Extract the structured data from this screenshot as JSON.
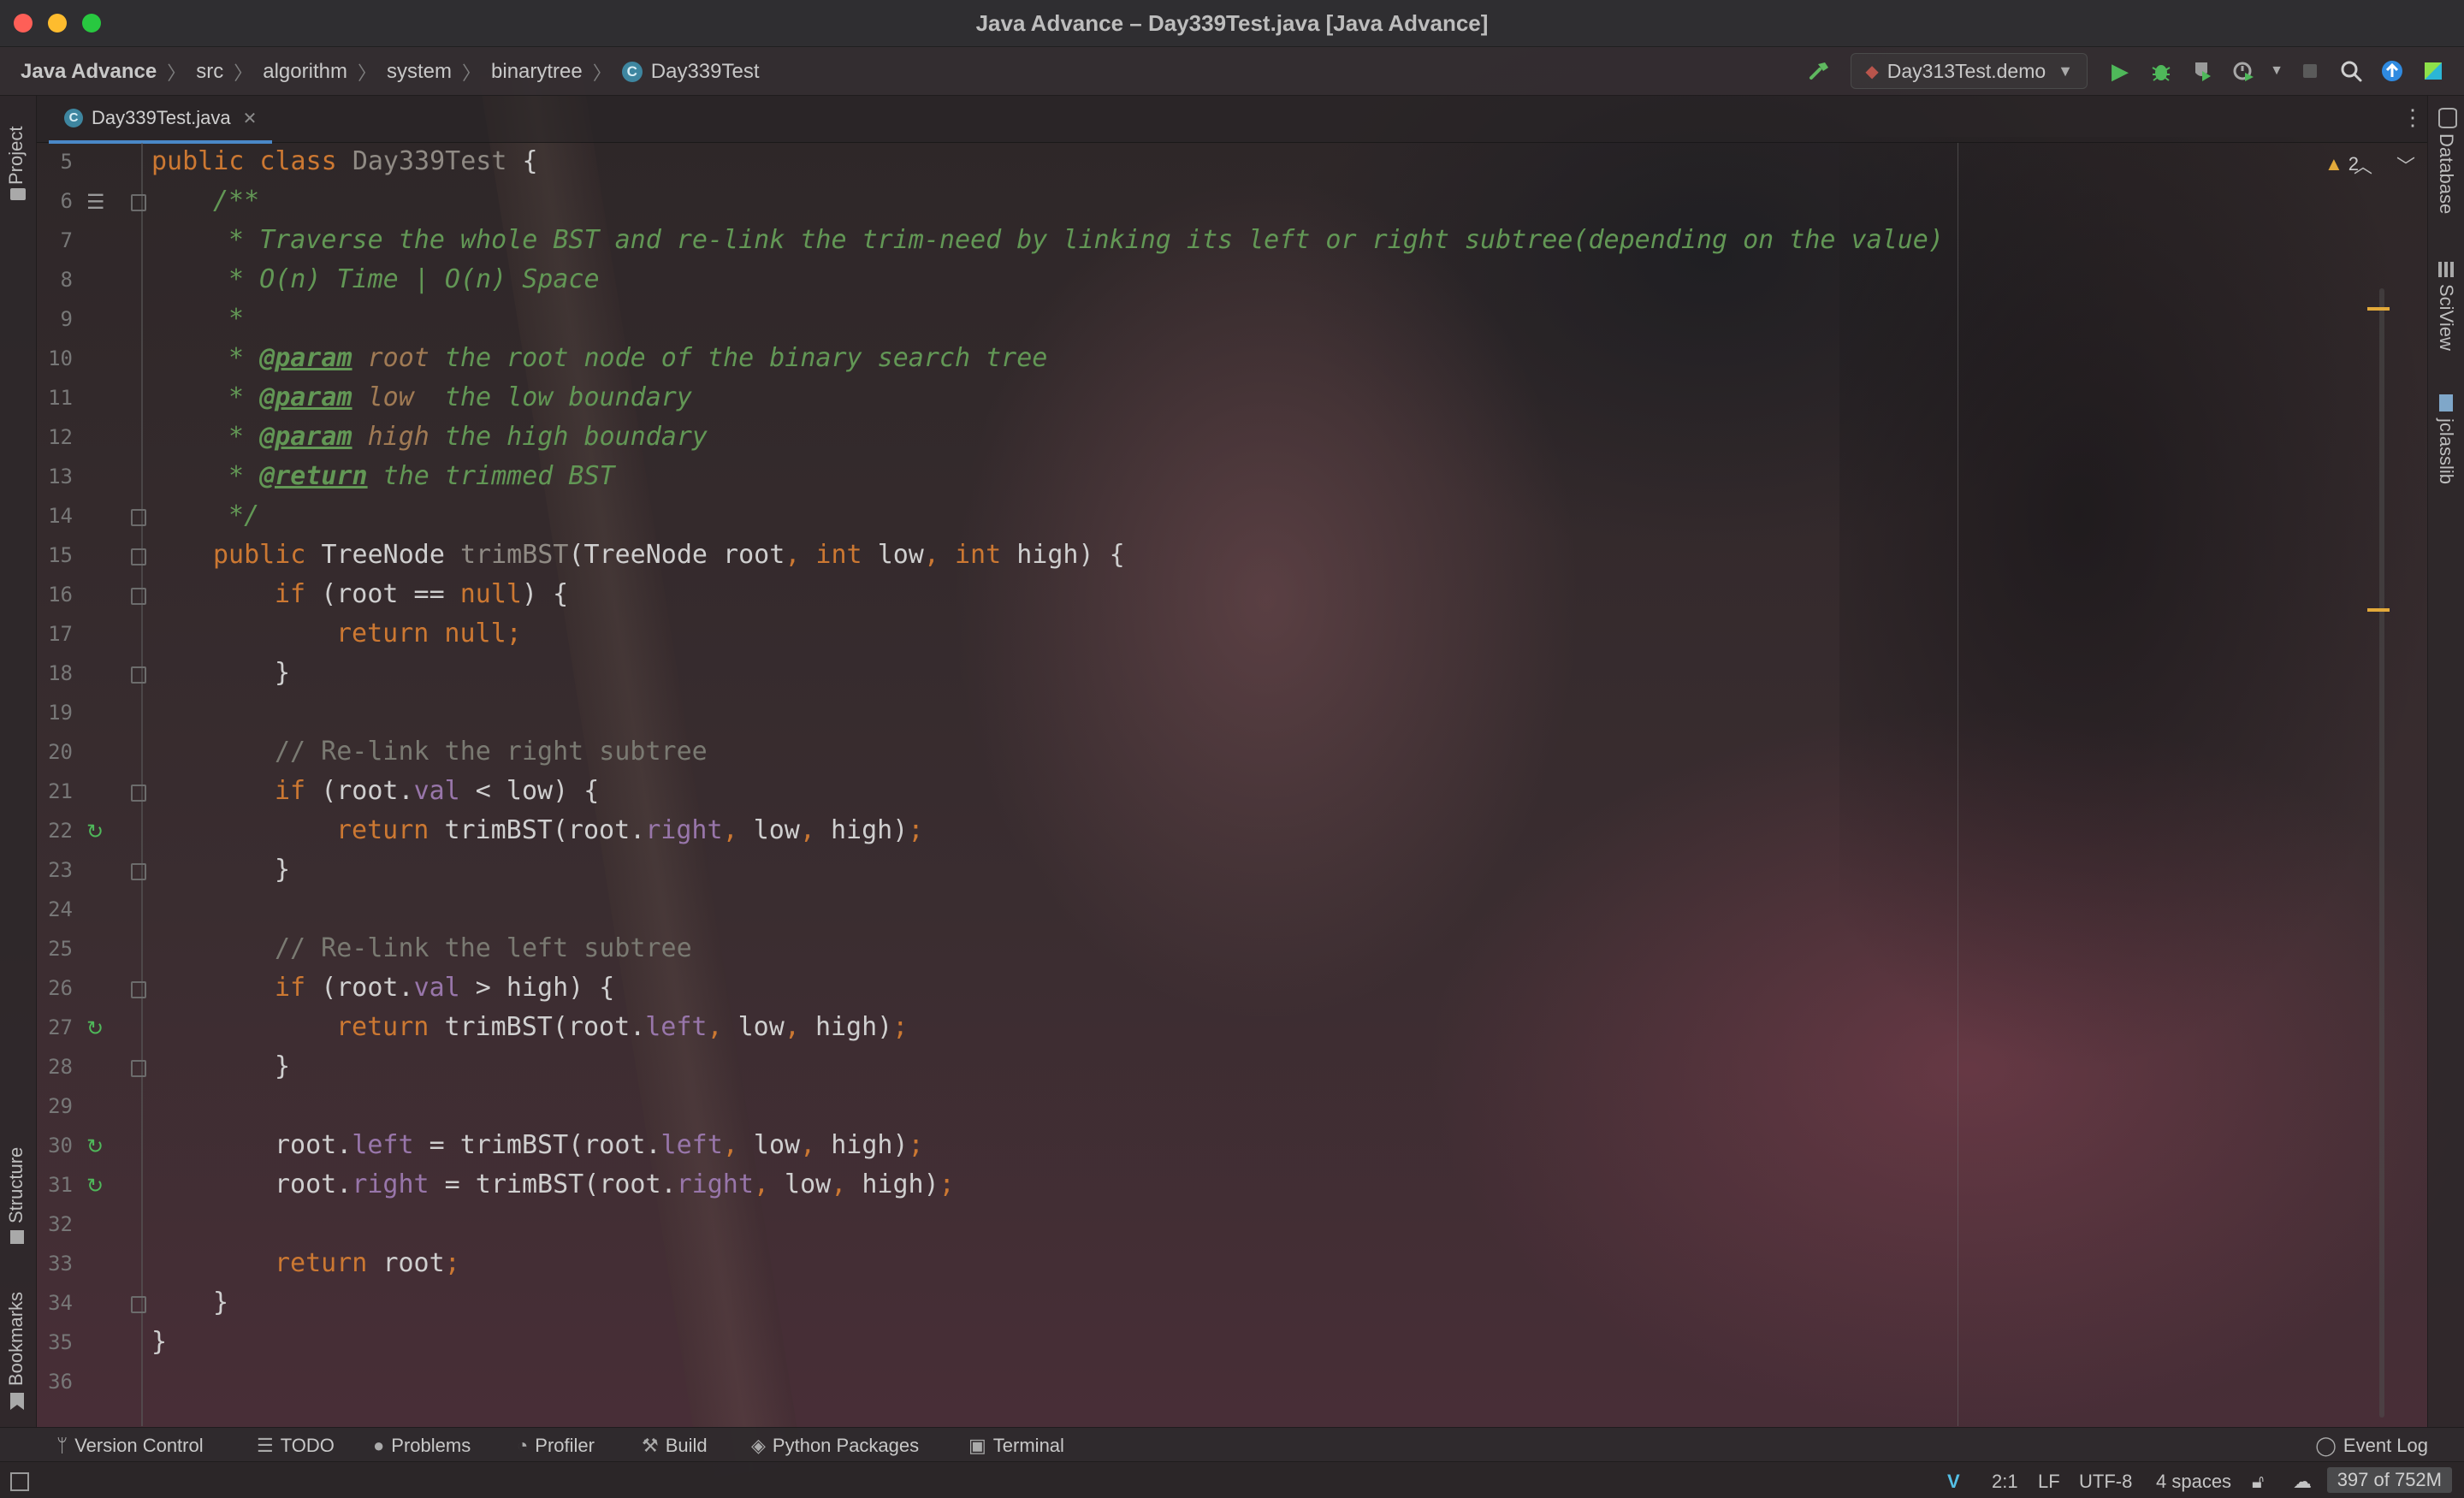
{
  "window": {
    "title": "Java Advance – Day339Test.java [Java Advance]"
  },
  "breadcrumbs": [
    "Java Advance",
    "src",
    "algorithm",
    "system",
    "binarytree",
    "Day339Test"
  ],
  "toolbar": {
    "run_config": "Day313Test.demo"
  },
  "left_strip": {
    "project": "Project",
    "structure": "Structure",
    "bookmarks": "Bookmarks"
  },
  "right_strip": {
    "database": "Database",
    "sciview": "SciView",
    "jclasslib": "jclasslib"
  },
  "tab": {
    "label": "Day339Test.java"
  },
  "inspection": {
    "warnings": "2"
  },
  "editor": {
    "lines": [
      {
        "n": "5",
        "indent": 0,
        "tokens": [
          [
            "kw",
            "public class "
          ],
          [
            "decl",
            "Day339Test"
          ],
          [
            "p",
            " {"
          ]
        ]
      },
      {
        "n": "6",
        "indent": 1,
        "tokens": [
          [
            "doc",
            "/**"
          ]
        ]
      },
      {
        "n": "7",
        "indent": 1,
        "tokens": [
          [
            "doc",
            " * Traverse the whole BST and re-link the trim-need by linking its left or right subtree(depending on the value)"
          ]
        ]
      },
      {
        "n": "8",
        "indent": 1,
        "tokens": [
          [
            "doc",
            " * O(n) Time | O(n) Space"
          ]
        ]
      },
      {
        "n": "9",
        "indent": 1,
        "tokens": [
          [
            "doc",
            " *"
          ]
        ]
      },
      {
        "n": "10",
        "indent": 1,
        "tokens": [
          [
            "doc",
            " * "
          ],
          [
            "tag",
            "@param"
          ],
          [
            "doc",
            " "
          ],
          [
            "pname",
            "root"
          ],
          [
            "doc",
            " the root node of the binary search tree"
          ]
        ]
      },
      {
        "n": "11",
        "indent": 1,
        "tokens": [
          [
            "doc",
            " * "
          ],
          [
            "tag",
            "@param"
          ],
          [
            "doc",
            " "
          ],
          [
            "pname",
            "low"
          ],
          [
            "doc",
            "  the low boundary"
          ]
        ]
      },
      {
        "n": "12",
        "indent": 1,
        "tokens": [
          [
            "doc",
            " * "
          ],
          [
            "tag",
            "@param"
          ],
          [
            "doc",
            " "
          ],
          [
            "pname",
            "high"
          ],
          [
            "doc",
            " the high boundary"
          ]
        ]
      },
      {
        "n": "13",
        "indent": 1,
        "tokens": [
          [
            "doc",
            " * "
          ],
          [
            "tag",
            "@return"
          ],
          [
            "doc",
            " the trimmed BST"
          ]
        ]
      },
      {
        "n": "14",
        "indent": 1,
        "tokens": [
          [
            "doc",
            " */"
          ]
        ]
      },
      {
        "n": "15",
        "indent": 1,
        "tokens": [
          [
            "kw",
            "public "
          ],
          [
            "p",
            "TreeNode "
          ],
          [
            "decl",
            "trimBST"
          ],
          [
            "p",
            "(TreeNode root"
          ],
          [
            "kw",
            ", int "
          ],
          [
            "p",
            "low"
          ],
          [
            "kw",
            ", int "
          ],
          [
            "p",
            "high) {"
          ]
        ]
      },
      {
        "n": "16",
        "indent": 2,
        "tokens": [
          [
            "kw",
            "if "
          ],
          [
            "p",
            "(root == "
          ],
          [
            "kw",
            "null"
          ],
          [
            "p",
            ") {"
          ]
        ]
      },
      {
        "n": "17",
        "indent": 3,
        "tokens": [
          [
            "kw",
            "return null;"
          ]
        ]
      },
      {
        "n": "18",
        "indent": 2,
        "tokens": [
          [
            "p",
            "}"
          ]
        ]
      },
      {
        "n": "19",
        "indent": 0,
        "tokens": []
      },
      {
        "n": "20",
        "indent": 2,
        "tokens": [
          [
            "cm",
            "// Re-link the right subtree"
          ]
        ]
      },
      {
        "n": "21",
        "indent": 2,
        "tokens": [
          [
            "kw",
            "if "
          ],
          [
            "p",
            "(root."
          ],
          [
            "fld",
            "val"
          ],
          [
            "p",
            " < low) {"
          ]
        ]
      },
      {
        "n": "22",
        "indent": 3,
        "tokens": [
          [
            "kw",
            "return "
          ],
          [
            "p",
            "trimBST(root."
          ],
          [
            "fld",
            "right"
          ],
          [
            "kw",
            ", "
          ],
          [
            "p",
            "low"
          ],
          [
            "kw",
            ", "
          ],
          [
            "p",
            "high)"
          ],
          [
            "kw",
            ";"
          ]
        ]
      },
      {
        "n": "23",
        "indent": 2,
        "tokens": [
          [
            "p",
            "}"
          ]
        ]
      },
      {
        "n": "24",
        "indent": 0,
        "tokens": []
      },
      {
        "n": "25",
        "indent": 2,
        "tokens": [
          [
            "cm",
            "// Re-link the left subtree"
          ]
        ]
      },
      {
        "n": "26",
        "indent": 2,
        "tokens": [
          [
            "kw",
            "if "
          ],
          [
            "p",
            "(root."
          ],
          [
            "fld",
            "val"
          ],
          [
            "p",
            " > high) {"
          ]
        ]
      },
      {
        "n": "27",
        "indent": 3,
        "tokens": [
          [
            "kw",
            "return "
          ],
          [
            "p",
            "trimBST(root."
          ],
          [
            "fld",
            "left"
          ],
          [
            "kw",
            ", "
          ],
          [
            "p",
            "low"
          ],
          [
            "kw",
            ", "
          ],
          [
            "p",
            "high)"
          ],
          [
            "kw",
            ";"
          ]
        ]
      },
      {
        "n": "28",
        "indent": 2,
        "tokens": [
          [
            "p",
            "}"
          ]
        ]
      },
      {
        "n": "29",
        "indent": 0,
        "tokens": []
      },
      {
        "n": "30",
        "indent": 2,
        "tokens": [
          [
            "p",
            "root."
          ],
          [
            "fld",
            "left"
          ],
          [
            "p",
            " = trimBST(root."
          ],
          [
            "fld",
            "left"
          ],
          [
            "kw",
            ", "
          ],
          [
            "p",
            "low"
          ],
          [
            "kw",
            ", "
          ],
          [
            "p",
            "high)"
          ],
          [
            "kw",
            ";"
          ]
        ]
      },
      {
        "n": "31",
        "indent": 2,
        "tokens": [
          [
            "p",
            "root."
          ],
          [
            "fld",
            "right"
          ],
          [
            "p",
            " = trimBST(root."
          ],
          [
            "fld",
            "right"
          ],
          [
            "kw",
            ", "
          ],
          [
            "p",
            "low"
          ],
          [
            "kw",
            ", "
          ],
          [
            "p",
            "high)"
          ],
          [
            "kw",
            ";"
          ]
        ]
      },
      {
        "n": "32",
        "indent": 0,
        "tokens": []
      },
      {
        "n": "33",
        "indent": 2,
        "tokens": [
          [
            "kw",
            "return "
          ],
          [
            "p",
            "root"
          ],
          [
            "kw",
            ";"
          ]
        ]
      },
      {
        "n": "34",
        "indent": 1,
        "tokens": [
          [
            "p",
            "}"
          ]
        ]
      },
      {
        "n": "35",
        "indent": 0,
        "tokens": [
          [
            "p",
            "}"
          ]
        ]
      },
      {
        "n": "36",
        "indent": 0,
        "tokens": []
      }
    ]
  },
  "tool_windows": {
    "version_control": "Version Control",
    "todo": "TODO",
    "problems": "Problems",
    "profiler": "Profiler",
    "build": "Build",
    "python_packages": "Python Packages",
    "terminal": "Terminal",
    "event_log": "Event Log"
  },
  "status": {
    "position": "2:1",
    "line_separator": "LF",
    "encoding": "UTF-8",
    "indent": "4 spaces",
    "memory": "397 of 752M"
  },
  "colors": {
    "keyword": "#cc7832",
    "doc_comment": "#629755",
    "field": "#9876aa",
    "line_comment": "#7a7a72",
    "accent_tab": "#4a88c7"
  }
}
